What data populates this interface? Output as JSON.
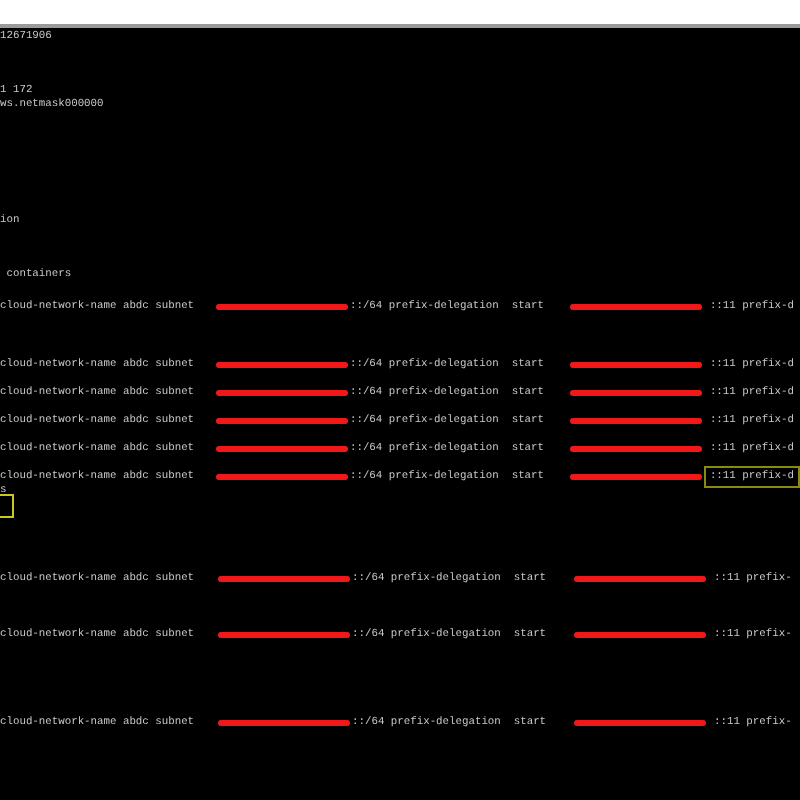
{
  "terminal": {
    "lines": [
      {
        "kind": "text",
        "text": "12671906"
      },
      {
        "kind": "text",
        "text": "1 172"
      },
      {
        "kind": "text",
        "text": "ws.netmask000000"
      },
      {
        "kind": "text",
        "text": "ion"
      },
      {
        "kind": "text",
        "text": " containers"
      },
      {
        "kind": "subnet",
        "head": "cloud-network-name abdc subnet ",
        "middle": "::/64 prefix-delegation  start ",
        "tail": "::11 prefix-d",
        "tail_highlighted": false
      },
      {
        "kind": "subnet",
        "head": "cloud-network-name abdc subnet ",
        "middle": "::/64 prefix-delegation  start ",
        "tail": "::11 prefix-d",
        "tail_highlighted": false
      },
      {
        "kind": "subnet",
        "head": "cloud-network-name abdc subnet ",
        "middle": "::/64 prefix-delegation  start ",
        "tail": "::11 prefix-d",
        "tail_highlighted": false
      },
      {
        "kind": "subnet",
        "head": "cloud-network-name abdc subnet ",
        "middle": "::/64 prefix-delegation  start ",
        "tail": "::11 prefix-d",
        "tail_highlighted": false
      },
      {
        "kind": "subnet",
        "head": "cloud-network-name abdc subnet ",
        "middle": "::/64 prefix-delegation  start ",
        "tail": "::11 prefix-d",
        "tail_highlighted": false
      },
      {
        "kind": "subnet",
        "head": "cloud-network-name abdc subnet ",
        "middle": "::/64 prefix-delegation  start ",
        "tail": "::11 prefix-d",
        "tail_highlighted": true
      },
      {
        "kind": "text",
        "text": "s"
      },
      {
        "kind": "marker"
      },
      {
        "kind": "subnet",
        "head": "cloud-network-name abdc subnet ",
        "middle": "::/64 prefix-delegation  start ",
        "tail": "::11 prefix-",
        "tail_highlighted": false
      },
      {
        "kind": "subnet",
        "head": "cloud-network-name abdc subnet ",
        "middle": "::/64 prefix-delegation  start ",
        "tail": "::11 prefix-",
        "tail_highlighted": false
      },
      {
        "kind": "subnet",
        "head": "cloud-network-name abdc subnet ",
        "middle": "::/64 prefix-delegation  start ",
        "tail": "::11 prefix-",
        "tail_highlighted": false
      }
    ]
  }
}
